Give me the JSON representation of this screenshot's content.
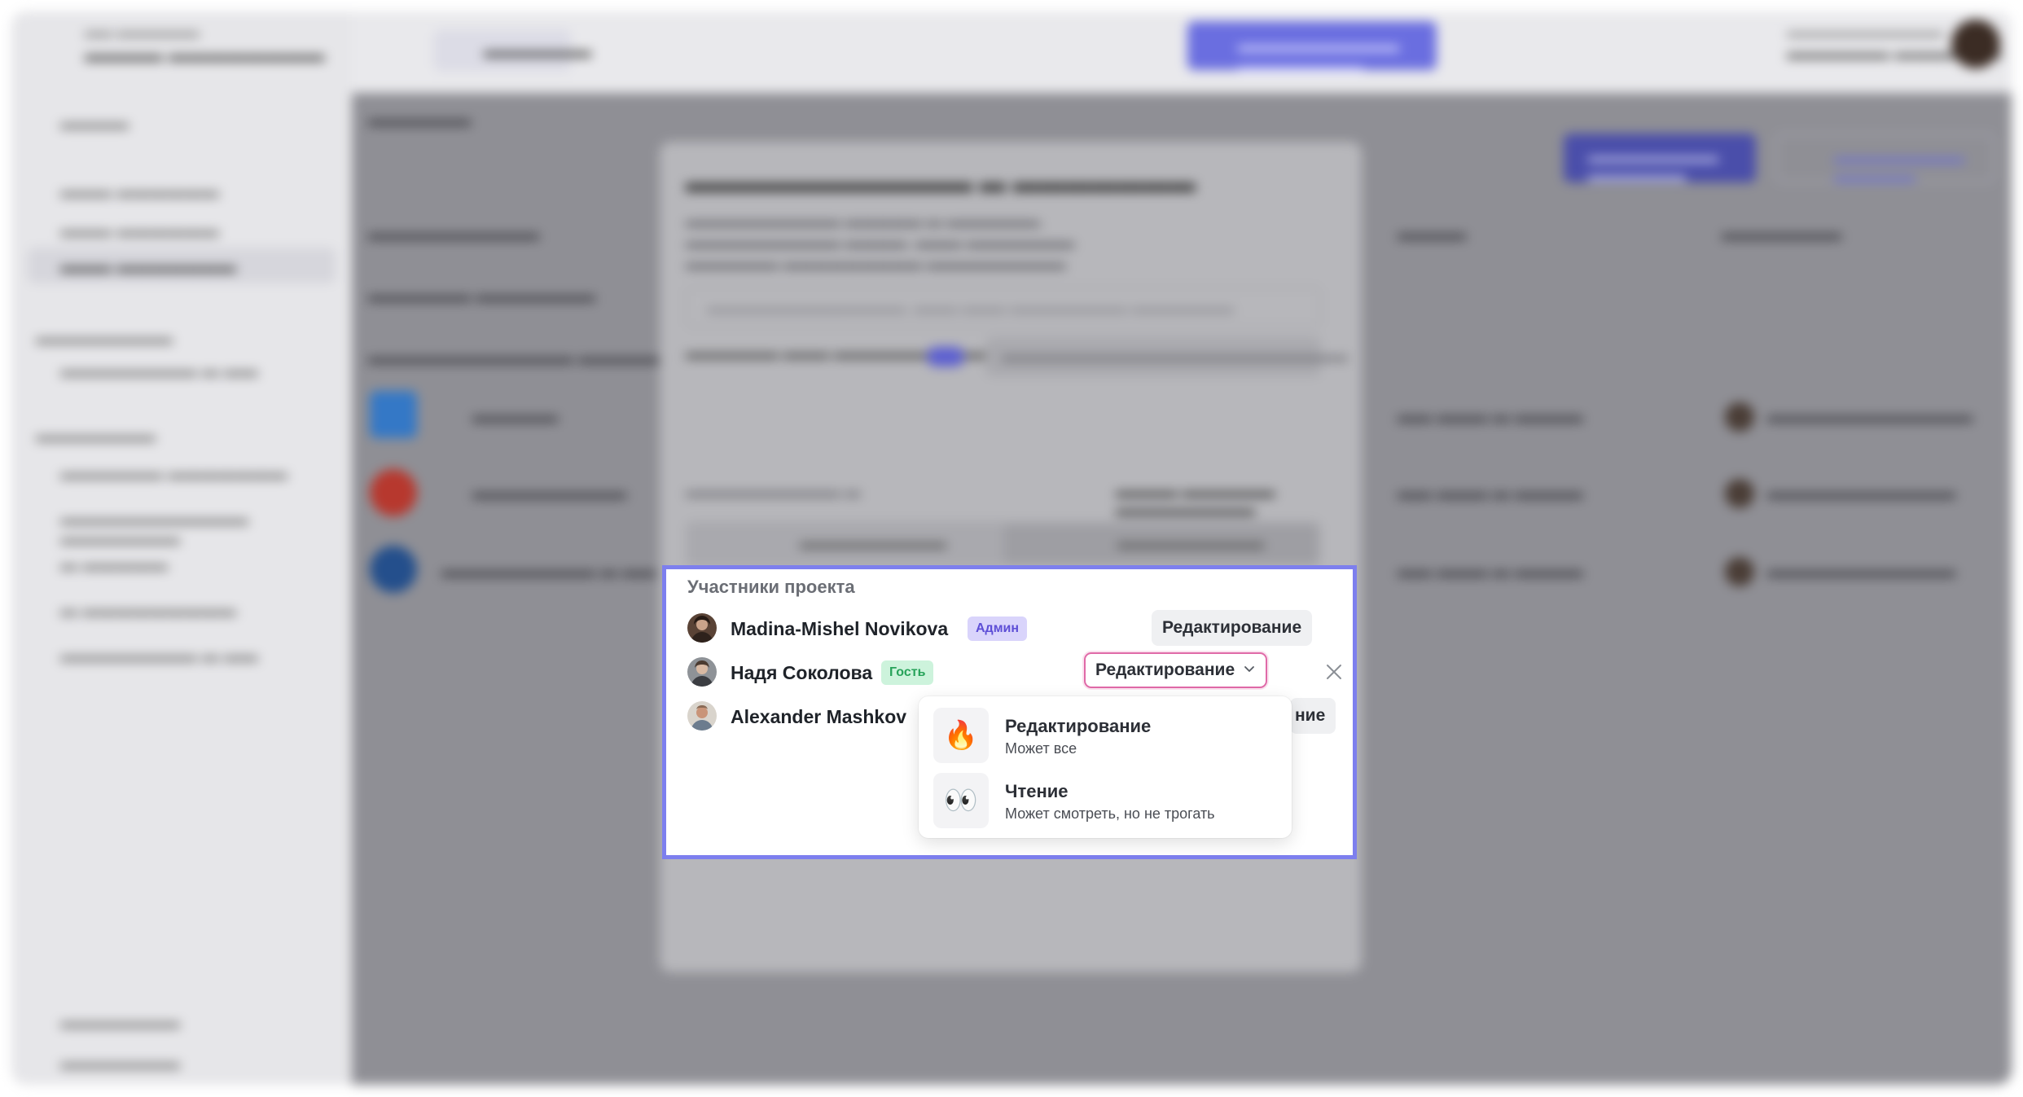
{
  "members_panel": {
    "title": "Участники проекта",
    "members": [
      {
        "name": "Madina-Mishel Novikova",
        "badge": "Админ",
        "role": "Редактирование"
      },
      {
        "name": "Надя Соколова",
        "badge": "Гость",
        "role": "Редактирование"
      },
      {
        "name": "Alexander Mashkov",
        "badge": "",
        "role_partial": "ние"
      }
    ]
  },
  "role_dropdown": {
    "options": [
      {
        "icon": "fire-icon",
        "glyph": "🔥",
        "title": "Редактирование",
        "description": "Может все"
      },
      {
        "icon": "eyes-icon",
        "glyph": "👀",
        "title": "Чтение",
        "description": "Может смотреть, но не трогать"
      }
    ]
  },
  "colors": {
    "focus_border": "#7d7fee",
    "select_border": "#e06aa8",
    "admin_badge_bg": "#d9d4fb",
    "guest_badge_bg": "#cdf3dc",
    "accent": "#6a6ee0"
  }
}
